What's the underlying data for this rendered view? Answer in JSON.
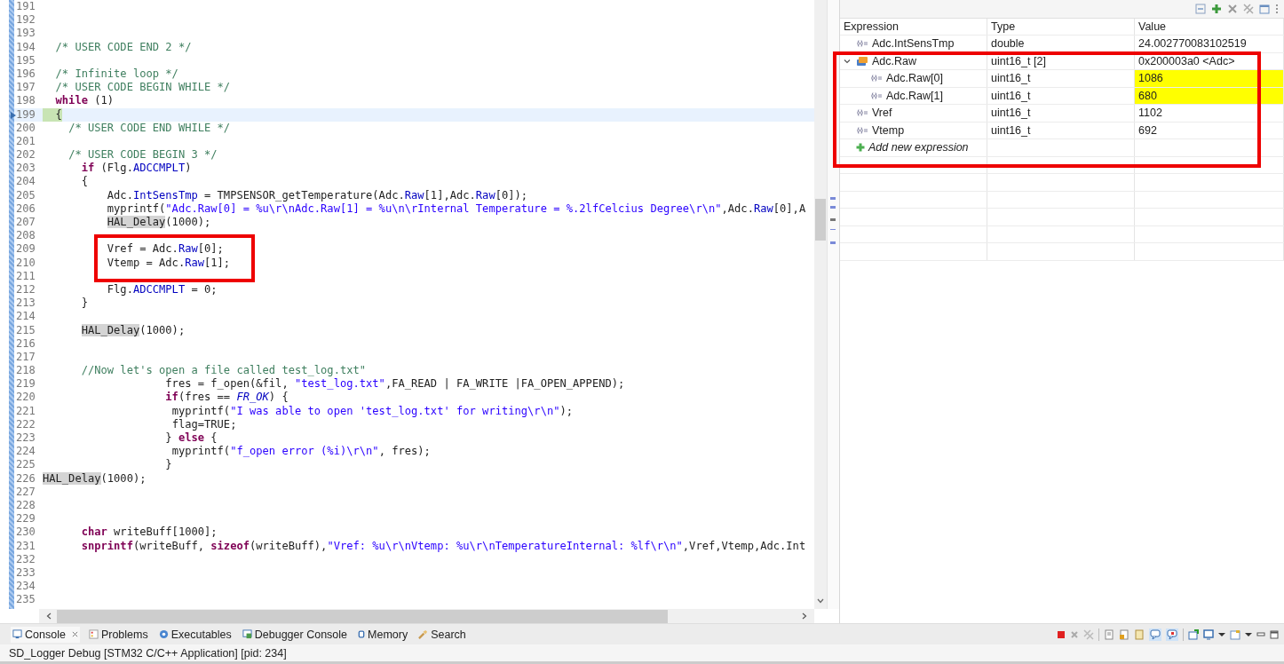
{
  "editor": {
    "lines": [
      {
        "number": "191"
      },
      {
        "number": "192"
      },
      {
        "number": "193"
      },
      {
        "number": "194",
        "tokens": [
          {
            "kind": "comment",
            "text": "  /* USER CODE END 2 */"
          }
        ]
      },
      {
        "number": "195"
      },
      {
        "number": "196",
        "tokens": [
          {
            "kind": "comment",
            "text": "  /* Infinite loop */"
          }
        ]
      },
      {
        "number": "197",
        "tokens": [
          {
            "kind": "comment",
            "text": "  /* USER CODE BEGIN WHILE */"
          }
        ]
      },
      {
        "number": "198",
        "tokens": [
          {
            "kind": "keyword",
            "text": "  while"
          },
          {
            "kind": "plain",
            "text": " (1)"
          }
        ]
      },
      {
        "number": "199",
        "current": true,
        "tokens": [
          {
            "kind": "plain",
            "text": "  {"
          }
        ]
      },
      {
        "number": "200",
        "tokens": [
          {
            "kind": "comment",
            "text": "    /* USER CODE END WHILE */"
          }
        ]
      },
      {
        "number": "201"
      },
      {
        "number": "202",
        "tokens": [
          {
            "kind": "comment",
            "text": "    /* USER CODE BEGIN 3 */"
          }
        ]
      },
      {
        "number": "203",
        "tokens": [
          {
            "kind": "keyword",
            "text": "      if"
          },
          {
            "kind": "plain",
            "text": " (Flg."
          },
          {
            "kind": "field",
            "text": "ADCCMPLT"
          },
          {
            "kind": "plain",
            "text": ")"
          }
        ]
      },
      {
        "number": "204",
        "tokens": [
          {
            "kind": "plain",
            "text": "      {"
          }
        ]
      },
      {
        "number": "205",
        "tokens": [
          {
            "kind": "plain",
            "text": "          Adc."
          },
          {
            "kind": "field",
            "text": "IntSensTmp"
          },
          {
            "kind": "plain",
            "text": " = TMPSENSOR_getTemperature(Adc."
          },
          {
            "kind": "field",
            "text": "Raw"
          },
          {
            "kind": "plain",
            "text": "[1],Adc."
          },
          {
            "kind": "field",
            "text": "Raw"
          },
          {
            "kind": "plain",
            "text": "[0]);"
          }
        ]
      },
      {
        "number": "206",
        "tokens": [
          {
            "kind": "plain",
            "text": "          myprintf("
          },
          {
            "kind": "string",
            "text": "\"Adc.Raw[0] = %u\\r\\nAdc.Raw[1] = %u\\n\\rInternal Temperature = %.2lfCelcius Degree\\r\\n\""
          },
          {
            "kind": "plain",
            "text": ",Adc."
          },
          {
            "kind": "field",
            "text": "Raw"
          },
          {
            "kind": "plain",
            "text": "[0],A"
          }
        ]
      },
      {
        "number": "207",
        "tokens": [
          {
            "kind": "occurrence",
            "text": "          HAL_Delay"
          },
          {
            "kind": "plain",
            "text": "(1000);"
          }
        ]
      },
      {
        "number": "208"
      },
      {
        "number": "209",
        "tokens": [
          {
            "kind": "plain",
            "text": "          Vref = Adc."
          },
          {
            "kind": "field",
            "text": "Raw"
          },
          {
            "kind": "plain",
            "text": "[0];"
          }
        ]
      },
      {
        "number": "210",
        "tokens": [
          {
            "kind": "plain",
            "text": "          Vtemp = Adc."
          },
          {
            "kind": "field",
            "text": "Raw"
          },
          {
            "kind": "plain",
            "text": "[1];"
          }
        ]
      },
      {
        "number": "211"
      },
      {
        "number": "212",
        "tokens": [
          {
            "kind": "plain",
            "text": "          Flg."
          },
          {
            "kind": "field",
            "text": "ADCCMPLT"
          },
          {
            "kind": "plain",
            "text": " = 0;"
          }
        ]
      },
      {
        "number": "213",
        "tokens": [
          {
            "kind": "plain",
            "text": "      }"
          }
        ]
      },
      {
        "number": "214"
      },
      {
        "number": "215",
        "tokens": [
          {
            "kind": "occurrence",
            "text": "      HAL_Delay"
          },
          {
            "kind": "plain",
            "text": "(1000);"
          }
        ]
      },
      {
        "number": "216"
      },
      {
        "number": "217"
      },
      {
        "number": "218",
        "tokens": [
          {
            "kind": "comment",
            "text": "      //Now let's open a file called test_log.txt\""
          }
        ]
      },
      {
        "number": "219",
        "tokens": [
          {
            "kind": "plain",
            "text": "                   fres = f_open(&fil, "
          },
          {
            "kind": "string",
            "text": "\"test_log.txt\""
          },
          {
            "kind": "plain",
            "text": ",FA_READ | FA_WRITE |FA_OPEN_APPEND);"
          }
        ]
      },
      {
        "number": "220",
        "tokens": [
          {
            "kind": "keyword",
            "text": "                   if"
          },
          {
            "kind": "plain",
            "text": "(fres == "
          },
          {
            "kind": "constant",
            "text": "FR_OK"
          },
          {
            "kind": "plain",
            "text": ") {"
          }
        ]
      },
      {
        "number": "221",
        "tokens": [
          {
            "kind": "plain",
            "text": "                    myprintf("
          },
          {
            "kind": "string",
            "text": "\"I was able to open 'test_log.txt' for writing\\r\\n\""
          },
          {
            "kind": "plain",
            "text": ");"
          }
        ]
      },
      {
        "number": "222",
        "tokens": [
          {
            "kind": "plain",
            "text": "                    flag=TRUE;"
          }
        ]
      },
      {
        "number": "223",
        "tokens": [
          {
            "kind": "plain",
            "text": "                   } "
          },
          {
            "kind": "keyword",
            "text": "else"
          },
          {
            "kind": "plain",
            "text": " {"
          }
        ]
      },
      {
        "number": "224",
        "tokens": [
          {
            "kind": "plain",
            "text": "                    myprintf("
          },
          {
            "kind": "string",
            "text": "\"f_open error (%i)\\r\\n\""
          },
          {
            "kind": "plain",
            "text": ", fres);"
          }
        ]
      },
      {
        "number": "225",
        "tokens": [
          {
            "kind": "plain",
            "text": "                   }"
          }
        ]
      },
      {
        "number": "226",
        "tokens": [
          {
            "kind": "occurrence",
            "text": "HAL_Delay"
          },
          {
            "kind": "plain",
            "text": "(1000);"
          }
        ]
      },
      {
        "number": "227"
      },
      {
        "number": "228"
      },
      {
        "number": "229"
      },
      {
        "number": "230",
        "tokens": [
          {
            "kind": "keyword",
            "text": "      char"
          },
          {
            "kind": "plain",
            "text": " writeBuff[1000];"
          }
        ]
      },
      {
        "number": "231",
        "tokens": [
          {
            "kind": "keyword",
            "text": "      snprintf"
          },
          {
            "kind": "plain",
            "text": "(writeBuff, "
          },
          {
            "kind": "keyword",
            "text": "sizeof"
          },
          {
            "kind": "plain",
            "text": "(writeBuff),"
          },
          {
            "kind": "string",
            "text": "\"Vref: %u\\r\\nVtemp: %u\\r\\nTemperatureInternal: %lf\\r\\n\""
          },
          {
            "kind": "plain",
            "text": ",Vref,Vtemp,Adc.Int"
          }
        ]
      },
      {
        "number": "232"
      },
      {
        "number": "233"
      },
      {
        "number": "234"
      },
      {
        "number": "235"
      }
    ]
  },
  "expressions": {
    "columns": [
      "Expression",
      "Type",
      "Value"
    ],
    "rows": [
      {
        "kind": "variable",
        "name": "Adc.IntSensTmp",
        "type": "double",
        "value": "24.002770083102519",
        "changed": false
      },
      {
        "kind": "array",
        "name": "Adc.Raw",
        "type": "uint16_t [2]",
        "value": "0x200003a0 <Adc>",
        "changed": false,
        "expanded": true,
        "children": [
          {
            "kind": "variable",
            "name": "Adc.Raw[0]",
            "type": "uint16_t",
            "value": "1086",
            "changed": true
          },
          {
            "kind": "variable",
            "name": "Adc.Raw[1]",
            "type": "uint16_t",
            "value": "680",
            "changed": true
          }
        ]
      },
      {
        "kind": "variable",
        "name": "Vref",
        "type": "uint16_t",
        "value": "1102",
        "changed": false
      },
      {
        "kind": "variable",
        "name": "Vtemp",
        "type": "uint16_t",
        "value": "692",
        "changed": false
      }
    ],
    "add_row": "Add new expression"
  },
  "console_tabs": [
    {
      "label": "Console",
      "selected": true,
      "kind": "console"
    },
    {
      "label": "Problems",
      "selected": false,
      "kind": "problems"
    },
    {
      "label": "Executables",
      "selected": false,
      "kind": "executables"
    },
    {
      "label": "Debugger Console",
      "selected": false,
      "kind": "debugger"
    },
    {
      "label": "Memory",
      "selected": false,
      "kind": "memory"
    },
    {
      "label": "Search",
      "selected": false,
      "kind": "search"
    }
  ],
  "status": "SD_Logger Debug [STM32 C/C++ Application] [pid: 234]"
}
